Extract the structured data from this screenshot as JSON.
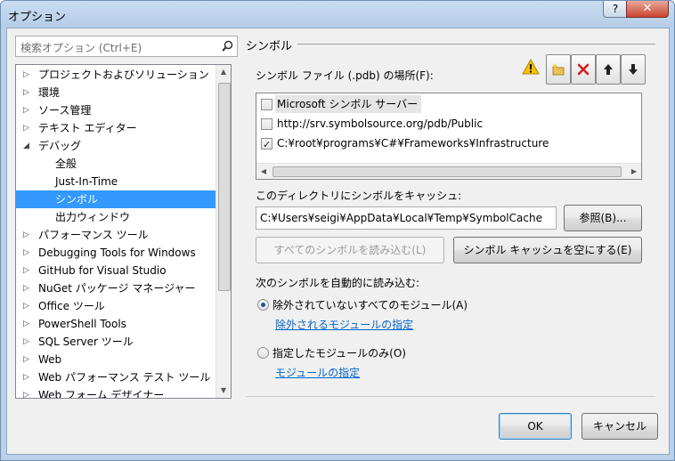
{
  "window": {
    "title": "オプション",
    "help_label": "?",
    "close_label": "✕"
  },
  "search": {
    "placeholder": "検索オプション (Ctrl+E)"
  },
  "tree": {
    "items": [
      {
        "label": "プロジェクトおよびソリューション",
        "arrow": "▷"
      },
      {
        "label": "環境",
        "arrow": "▷"
      },
      {
        "label": "ソース管理",
        "arrow": "▷"
      },
      {
        "label": "テキスト エディター",
        "arrow": "▷"
      },
      {
        "label": "デバッグ",
        "arrow": "◢"
      },
      {
        "label": "全般",
        "arrow": ""
      },
      {
        "label": "Just-In-Time",
        "arrow": ""
      },
      {
        "label": "シンボル",
        "arrow": ""
      },
      {
        "label": "出力ウィンドウ",
        "arrow": ""
      },
      {
        "label": "パフォーマンス ツール",
        "arrow": "▷"
      },
      {
        "label": "Debugging Tools for Windows",
        "arrow": "▷"
      },
      {
        "label": "GitHub for Visual Studio",
        "arrow": "▷"
      },
      {
        "label": "NuGet パッケージ マネージャー",
        "arrow": "▷"
      },
      {
        "label": "Office ツール",
        "arrow": "▷"
      },
      {
        "label": "PowerShell Tools",
        "arrow": "▷"
      },
      {
        "label": "SQL Server ツール",
        "arrow": "▷"
      },
      {
        "label": "Web",
        "arrow": "▷"
      },
      {
        "label": "Web パフォーマンス テスト ツール",
        "arrow": "▷"
      },
      {
        "label": "Web フォーム デザイナー",
        "arrow": "▷"
      }
    ],
    "selected": "シンボル"
  },
  "panel": {
    "section_title": "シンボル",
    "locations_label": "シンボル ファイル (.pdb) の場所(F):",
    "locations": [
      {
        "text": "Microsoft シンボル サーバー",
        "checked": false
      },
      {
        "text": "http://srv.symbolsource.org/pdb/Public",
        "checked": false
      },
      {
        "text": "C:¥root¥programs¥C#¥Frameworks¥Infrastructure",
        "checked": true
      }
    ],
    "cache_label": "このディレクトリにシンボルをキャッシュ:",
    "cache_path": "C:¥Users¥seigi¥AppData¥Local¥Temp¥SymbolCache",
    "browse_button": "参照(B)...",
    "load_all_button": "すべてのシンボルを読み込む(L)",
    "empty_cache_button": "シンボル キャッシュを空にする(E)",
    "auto_load_label": "次のシンボルを自動的に読み込む:",
    "radio_all_excluded": "除外されていないすべてのモジュール(A)",
    "link_excluded": "除外されるモジュールの指定",
    "radio_specified": "指定したモジュールのみ(O)",
    "link_specified": "モジュールの指定"
  },
  "footer": {
    "ok_label": "OK",
    "cancel_label": "キャンセル"
  },
  "colors": {
    "selection": "#3399ff",
    "link": "#0066cc",
    "warning": "#f3c200",
    "delete": "#d21d1d"
  }
}
